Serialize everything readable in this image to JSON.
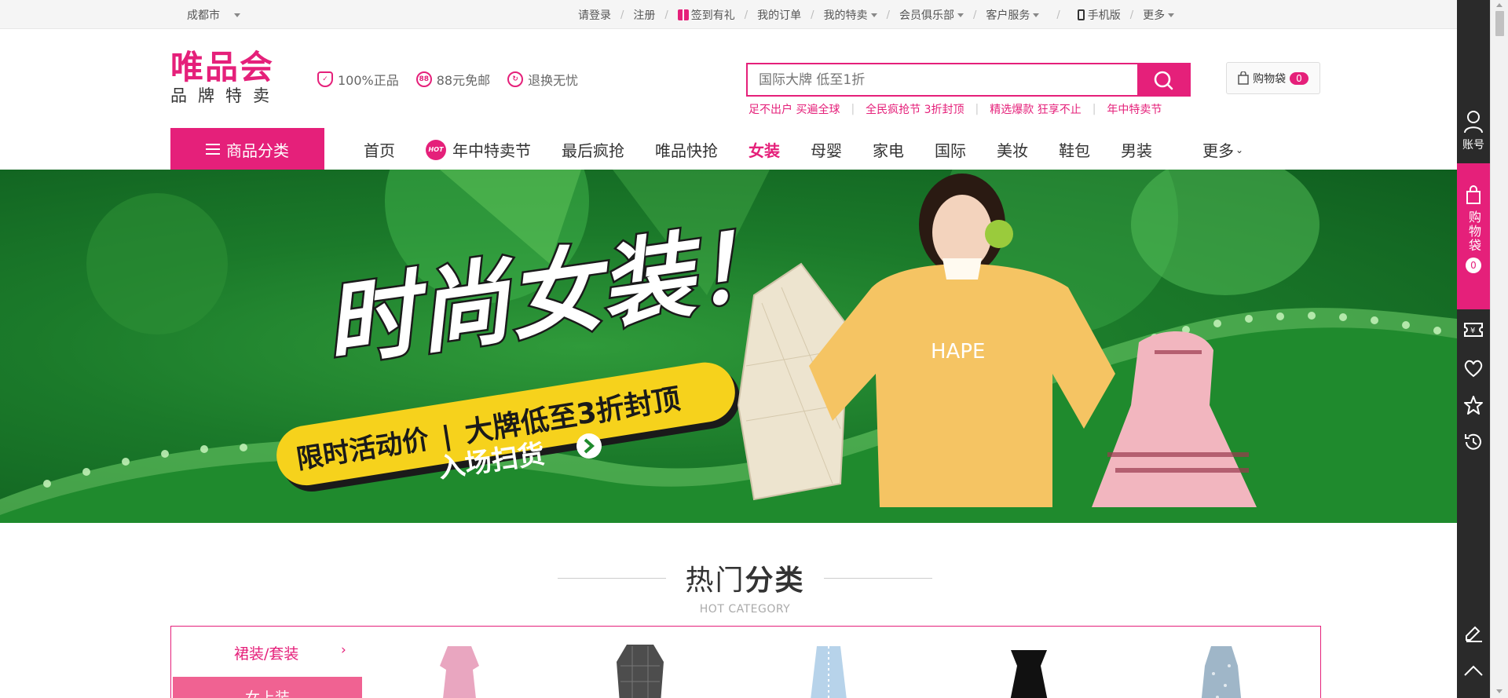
{
  "topbar": {
    "city": "成都市",
    "links": [
      {
        "label": "请登录",
        "dropdown": false
      },
      {
        "label": "注册",
        "dropdown": false
      },
      {
        "label": "签到有礼",
        "dropdown": false,
        "icon": "gift-icon"
      },
      {
        "label": "我的订单",
        "dropdown": false
      },
      {
        "label": "我的特卖",
        "dropdown": true
      },
      {
        "label": "会员俱乐部",
        "dropdown": true
      },
      {
        "label": "客户服务",
        "dropdown": true
      },
      {
        "label": "手机版",
        "dropdown": false,
        "icon": "phone-icon"
      },
      {
        "label": "更多",
        "dropdown": true
      }
    ]
  },
  "header": {
    "logo_main": "唯品会",
    "logo_sub": "品牌特卖",
    "promises": [
      {
        "label": "100%正品",
        "icon": "shield-check-icon"
      },
      {
        "label": "88元免邮",
        "icon": "free-shipping-icon",
        "badge": "88"
      },
      {
        "label": "退换无忧",
        "icon": "return-icon"
      }
    ],
    "search_placeholder": "国际大牌 低至1折",
    "hotwords": [
      "足不出户 买遍全球",
      "全民疯抢节 3折封顶",
      "精选爆款 狂享不止",
      "年中特卖节"
    ],
    "cart_label": "购物袋",
    "cart_count": "0"
  },
  "nav": {
    "category_button": "商品分类",
    "items": [
      {
        "label": "首页",
        "active": false
      },
      {
        "label": "年中特卖节",
        "active": false,
        "hot_badge": "HOT"
      },
      {
        "label": "最后疯抢",
        "active": false
      },
      {
        "label": "唯品快抢",
        "active": false
      },
      {
        "label": "女装",
        "active": true
      },
      {
        "label": "母婴",
        "active": false
      },
      {
        "label": "家电",
        "active": false
      },
      {
        "label": "国际",
        "active": false
      },
      {
        "label": "美妆",
        "active": false
      },
      {
        "label": "鞋包",
        "active": false
      },
      {
        "label": "男装",
        "active": false
      },
      {
        "label": "更多",
        "active": false,
        "dropdown": true
      }
    ]
  },
  "banner": {
    "headline": "时尚女装！",
    "tagline_left": "限时活动价",
    "tagline_right": "大牌低至3折封顶",
    "cta": "入场扫货",
    "shirt_text": "HAPE"
  },
  "hot_category": {
    "title_light": "热门",
    "title_bold": "分类",
    "subtitle": "HOT CATEGORY",
    "categories": [
      "裙装/套装",
      "女上装"
    ]
  },
  "sidebar": {
    "account_label": "账号",
    "bag_label": "购物袋",
    "bag_count": "0"
  },
  "colors": {
    "brand": "#e5207a",
    "banner_green": "#1b7a2a",
    "banner_yellow": "#f6d21c",
    "sidebar_dark": "#2a2a2a"
  }
}
